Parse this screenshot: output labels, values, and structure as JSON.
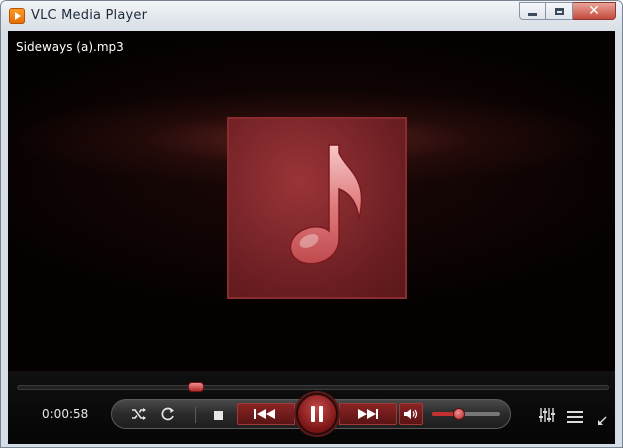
{
  "window": {
    "title": "VLC Media Player"
  },
  "player": {
    "filename": "Sideways (a).mp3",
    "elapsed": "0:00:58",
    "seek_fraction": 0.3,
    "volume_fraction": 0.38,
    "state": "playing"
  },
  "icons": {
    "app": "vlc-cone-icon",
    "album_art": "music-note-icon",
    "shuffle": "shuffle-icon",
    "repeat": "repeat-icon",
    "stop": "stop-icon",
    "previous": "previous-track-icon",
    "pause": "pause-icon",
    "next": "next-track-icon",
    "volume": "speaker-icon",
    "equalizer": "equalizer-icon",
    "playlist": "playlist-icon",
    "minimize_view": "collapse-arrow-icon"
  },
  "colors": {
    "accent": "#b42a2a",
    "art_background": "#7a2226",
    "titlebar": "#e1e6ec"
  }
}
